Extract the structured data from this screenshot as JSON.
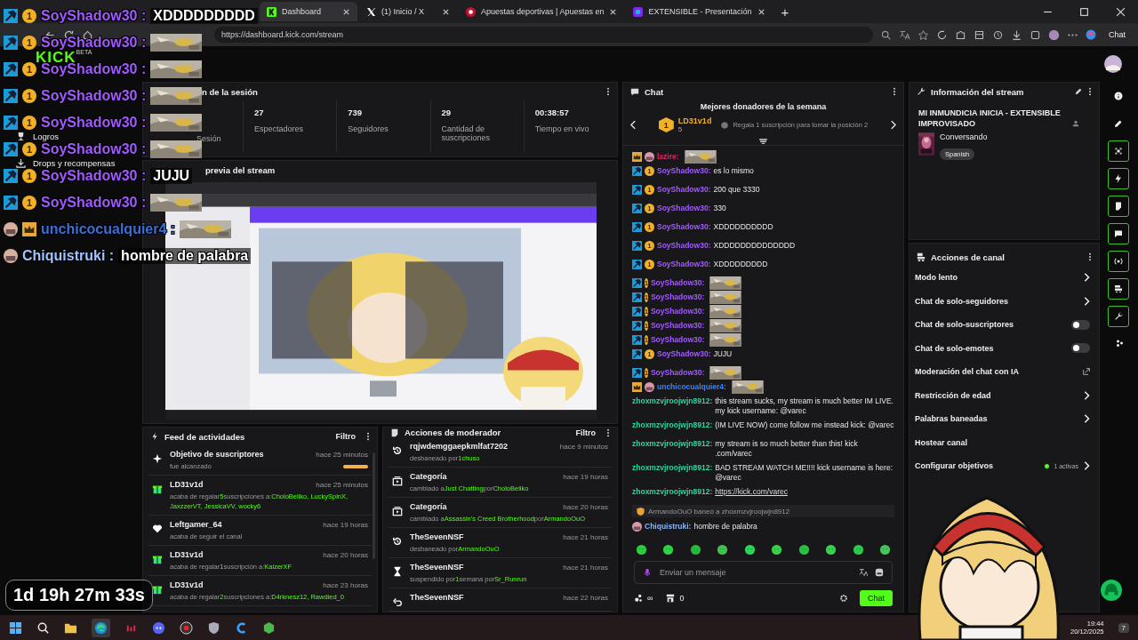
{
  "browser": {
    "tabs": [
      {
        "label": "Dashboard",
        "selected": true
      },
      {
        "label": "(1) Inicio / X",
        "selected": false
      },
      {
        "label": "Apuestas deportivas | Apuestas en",
        "selected": false
      },
      {
        "label": "EXTENSIBLE - Presentación",
        "selected": false
      }
    ],
    "new_tab": "+",
    "url": "https://dashboard.kick.com/stream",
    "chat_button": "Chat"
  },
  "sidebar": {
    "logo": "KICK",
    "beta": "BETA",
    "items": [
      {
        "label": "Logros"
      },
      {
        "label": "Drops y recompensas"
      }
    ]
  },
  "session": {
    "title": "n de la sesión",
    "stats": [
      {
        "label": "Sesión"
      },
      {
        "value": "27",
        "label": "Espectadores"
      },
      {
        "value": "739",
        "label": "Seguidores"
      },
      {
        "value": "29",
        "label": "Cantidad de suscripciones"
      },
      {
        "value": "00:38:57",
        "label": "Tiempo en vivo"
      }
    ]
  },
  "preview": {
    "title": "previa del stream"
  },
  "feed": {
    "title": "Feed de actividades",
    "filter": "Filtro",
    "items": [
      {
        "kind": "goal",
        "name": "Objetivo de suscriptores",
        "time": "hace 25 minutos",
        "level": 1,
        "body": [
          {
            "text": "fue alcanzado",
            "highlight": false
          }
        ]
      },
      {
        "kind": "gift",
        "name": "LD31v1d",
        "time": "hace 25 minutos",
        "body": [
          {
            "text": "acaba de regalar",
            "highlight": false
          },
          {
            "text": "5",
            "highlight": true
          },
          {
            "text": "suscripciones a:",
            "highlight": false
          },
          {
            "text": "CholoBeliko, LuckySpinX, JaxzzerVT, JessicaVV, wocky6",
            "highlight": true
          }
        ]
      },
      {
        "kind": "follow",
        "name": "Leftgamer_64",
        "time": "hace 19 horas",
        "body": [
          {
            "text": "acaba de seguir el canal",
            "highlight": false
          }
        ]
      },
      {
        "kind": "gift",
        "name": "LD31v1d",
        "time": "hace 20 horas",
        "body": [
          {
            "text": "acaba de regalar",
            "highlight": false
          },
          {
            "text": "1",
            "highlight": true
          },
          {
            "text": "suscripción a:",
            "highlight": false
          },
          {
            "text": "KaizerXF",
            "highlight": true
          }
        ]
      },
      {
        "kind": "gift",
        "name": "LD31v1d",
        "time": "hace 23 horas",
        "body": [
          {
            "text": "acaba de regalar",
            "highlight": false
          },
          {
            "text": "2",
            "highlight": true
          },
          {
            "text": "suscripciones a:",
            "highlight": false
          },
          {
            "text": "D4rknesz12, Rawdied_0",
            "highlight": true
          }
        ]
      }
    ]
  },
  "mod_actions": {
    "title": "Acciones de moderador",
    "filter": "Filtro",
    "items": [
      {
        "kind": "unban",
        "name": "rqjwdemggaepkmlfat7202",
        "time": "hace 9 minutos",
        "body": [
          {
            "text": "desbaneado por",
            "highlight": false
          },
          {
            "text": "1chuso",
            "highlight": true
          }
        ]
      },
      {
        "kind": "category",
        "name": "Categoría",
        "time": "hace 19 horas",
        "body": [
          {
            "text": "cambiado a",
            "highlight": false
          },
          {
            "text": "Just Chatting",
            "highlight": true
          },
          {
            "text": "por",
            "highlight": false
          },
          {
            "text": "CholoBeliko",
            "highlight": true
          }
        ]
      },
      {
        "kind": "category",
        "name": "Categoría",
        "time": "hace 20 horas",
        "body": [
          {
            "text": "cambiado a",
            "highlight": false
          },
          {
            "text": "Assassin's Creed Brotherhood",
            "highlight": true
          },
          {
            "text": "por",
            "highlight": false
          },
          {
            "text": "ArmandoOuO",
            "highlight": true
          }
        ]
      },
      {
        "kind": "unban",
        "name": "TheSevenNSF",
        "time": "hace 21 horas",
        "body": [
          {
            "text": "desbaneado por",
            "highlight": false
          },
          {
            "text": "ArmandoOuO",
            "highlight": true
          }
        ]
      },
      {
        "kind": "timeout",
        "name": "TheSevenNSF",
        "time": "hace 21 horas",
        "body": [
          {
            "text": "suspendido por",
            "highlight": false
          },
          {
            "text": "1",
            "highlight": true
          },
          {
            "text": "semana por",
            "highlight": false
          },
          {
            "text": "Sr_Runrun",
            "highlight": true
          }
        ]
      },
      {
        "kind": "undo",
        "name": "TheSevenNSF",
        "time": "hace 22 horas"
      }
    ]
  },
  "chat": {
    "title": "Chat",
    "donors_title": "Mejores donadores de la semana",
    "donor": {
      "rank": "1",
      "name": "LD31v1d",
      "count": "5",
      "hint": "Regala 1 suscripción para tomar la posición 2"
    },
    "messages": [
      {
        "kind": "emote",
        "user": "lazire:",
        "color": "#e0245e",
        "badges": [
          {
            "kind": "crown"
          },
          {
            "kind": "avatar"
          }
        ]
      },
      {
        "kind": "text",
        "user": "SoyShadow30:",
        "color": "#a259ff",
        "badges": [
          {
            "kind": "mod"
          },
          {
            "kind": "rank",
            "text": "1"
          }
        ],
        "text": "es lo mismo"
      },
      {
        "kind": "text",
        "user": "SoyShadow30:",
        "color": "#a259ff",
        "badges": [
          {
            "kind": "mod"
          },
          {
            "kind": "rank",
            "text": "1"
          }
        ],
        "text": "200 que 3330"
      },
      {
        "kind": "text",
        "user": "SoyShadow30:",
        "color": "#a259ff",
        "badges": [
          {
            "kind": "mod"
          },
          {
            "kind": "rank",
            "text": "1"
          }
        ],
        "text": "330"
      },
      {
        "kind": "text",
        "user": "SoyShadow30:",
        "color": "#a259ff",
        "badges": [
          {
            "kind": "mod"
          },
          {
            "kind": "rank",
            "text": "1"
          }
        ],
        "text": "XDDDDDDDDDD"
      },
      {
        "kind": "text",
        "user": "SoyShadow30:",
        "color": "#a259ff",
        "badges": [
          {
            "kind": "mod"
          },
          {
            "kind": "rank",
            "text": "1"
          }
        ],
        "text": "XDDDDDDDDDDDDDD"
      },
      {
        "kind": "text",
        "user": "SoyShadow30:",
        "color": "#a259ff",
        "badges": [
          {
            "kind": "mod"
          },
          {
            "kind": "rank",
            "text": "1"
          }
        ],
        "text": "XDDDDDDDDD"
      },
      {
        "kind": "emote",
        "user": "SoyShadow30:",
        "color": "#a259ff",
        "badges": [
          {
            "kind": "mod"
          },
          {
            "kind": "rank",
            "text": "1"
          }
        ]
      },
      {
        "kind": "emote",
        "user": "SoyShadow30:",
        "color": "#a259ff",
        "badges": [
          {
            "kind": "mod"
          },
          {
            "kind": "rank",
            "text": "1"
          }
        ]
      },
      {
        "kind": "emote",
        "user": "SoyShadow30:",
        "color": "#a259ff",
        "badges": [
          {
            "kind": "mod"
          },
          {
            "kind": "rank",
            "text": "1"
          }
        ]
      },
      {
        "kind": "emote",
        "user": "SoyShadow30:",
        "color": "#a259ff",
        "badges": [
          {
            "kind": "mod"
          },
          {
            "kind": "rank",
            "text": "1"
          }
        ]
      },
      {
        "kind": "emote",
        "user": "SoyShadow30:",
        "color": "#a259ff",
        "badges": [
          {
            "kind": "mod"
          },
          {
            "kind": "rank",
            "text": "1"
          }
        ]
      },
      {
        "kind": "text",
        "user": "SoyShadow30:",
        "color": "#a259ff",
        "badges": [
          {
            "kind": "mod"
          },
          {
            "kind": "rank",
            "text": "1"
          }
        ],
        "text": "JUJU"
      },
      {
        "kind": "emote",
        "user": "SoyShadow30:",
        "color": "#a259ff",
        "badges": [
          {
            "kind": "mod"
          },
          {
            "kind": "rank",
            "text": "1"
          }
        ]
      },
      {
        "kind": "emote",
        "user": "unchicocualquier4:",
        "color": "#3b82f6",
        "badges": [
          {
            "kind": "crown"
          },
          {
            "kind": "avatar"
          }
        ]
      },
      {
        "kind": "text",
        "user": "zhoxmzvjroojwjn8912:",
        "color": "#2fd3a0",
        "text": "this stream sucks, my stream is much better IM LIVE. my kick username: @varec"
      },
      {
        "kind": "text",
        "user": "zhoxmzvjroojwjn8912:",
        "color": "#2fd3a0",
        "text": "(IM LIVE NOW) come follow me instead kick: @varec"
      },
      {
        "kind": "text",
        "user": "zhoxmzvjroojwjn8912:",
        "color": "#2fd3a0",
        "text": "my stream is so much better than this! kick .com/varec"
      },
      {
        "kind": "text",
        "user": "zhoxmzvjroojwjn8912:",
        "color": "#2fd3a0",
        "text": "BAD STREAM WATCH ME!!!! kick username is here: @varec"
      },
      {
        "kind": "link",
        "user": "zhoxmzvjroojwjn8912:",
        "color": "#2fd3a0",
        "text": "https://kick.com/varec"
      },
      {
        "kind": "system",
        "text": "ArmandoOuO baneó a zhoxmzvjroojwjn8912"
      },
      {
        "kind": "text",
        "user": "Chiquistruki:",
        "color": "#8ab4f8",
        "badges": [
          {
            "kind": "avatar"
          }
        ],
        "text": "hombre de palabra"
      }
    ],
    "placeholder": "Enviar un mensaje",
    "points": "∞",
    "drops": "0",
    "send": "Chat"
  },
  "stream_info": {
    "title": "Información del stream",
    "stream_title": "MI INMUNDICIA INICIA - EXTENSIBLE IMPROVISADO",
    "category": "Conversando",
    "tags": [
      "Spanish"
    ]
  },
  "channel_actions": {
    "title": "Acciones de canal",
    "items": [
      {
        "kind": "arrow",
        "label": "Modo lento"
      },
      {
        "kind": "arrow",
        "label": "Chat de solo-seguidores"
      },
      {
        "kind": "toggle",
        "label": "Chat de solo-suscriptores",
        "on": false
      },
      {
        "kind": "toggle",
        "label": "Chat de solo-emotes",
        "on": false
      },
      {
        "kind": "external",
        "label": "Moderación del chat con IA"
      },
      {
        "kind": "arrow",
        "label": "Restricción de edad"
      },
      {
        "kind": "arrow",
        "label": "Palabras baneadas"
      },
      {
        "kind": "plain",
        "label": "Hostear canal"
      },
      {
        "kind": "arrow",
        "label": "Configurar objetivos",
        "badge": "1 activas"
      }
    ]
  },
  "rail": [
    {
      "on": false
    },
    {
      "on": false
    },
    {
      "on": true
    },
    {
      "on": true
    },
    {
      "on": true
    },
    {
      "on": true
    },
    {
      "on": true
    },
    {
      "on": true
    },
    {
      "on": true
    },
    {
      "on": false
    }
  ],
  "overlay": {
    "lines": [
      {
        "kind": "text",
        "user": "SoyShadow30 :",
        "color": "#a259ff",
        "badges": [
          {
            "kind": "mod"
          },
          {
            "kind": "rank",
            "text": "1"
          }
        ],
        "text": "XDDDDDDDDD"
      },
      {
        "kind": "emote",
        "user": "SoyShadow30 :",
        "color": "#a259ff",
        "badges": [
          {
            "kind": "mod"
          },
          {
            "kind": "rank",
            "text": "1"
          }
        ]
      },
      {
        "kind": "emote",
        "user": "SoyShadow30 :",
        "color": "#a259ff",
        "badges": [
          {
            "kind": "mod"
          },
          {
            "kind": "rank",
            "text": "1"
          }
        ]
      },
      {
        "kind": "emote",
        "user": "SoyShadow30 :",
        "color": "#a259ff",
        "badges": [
          {
            "kind": "mod"
          },
          {
            "kind": "rank",
            "text": "1"
          }
        ]
      },
      {
        "kind": "emote",
        "user": "SoyShadow30 :",
        "color": "#a259ff",
        "badges": [
          {
            "kind": "mod"
          },
          {
            "kind": "rank",
            "text": "1"
          }
        ]
      },
      {
        "kind": "emote",
        "user": "SoyShadow30 :",
        "color": "#a259ff",
        "badges": [
          {
            "kind": "mod"
          },
          {
            "kind": "rank",
            "text": "1"
          }
        ]
      },
      {
        "kind": "text",
        "user": "SoyShadow30 :",
        "color": "#a259ff",
        "badges": [
          {
            "kind": "mod"
          },
          {
            "kind": "rank",
            "text": "1"
          }
        ],
        "text": "JUJU"
      },
      {
        "kind": "emote",
        "user": "SoyShadow30 :",
        "color": "#a259ff",
        "badges": [
          {
            "kind": "mod"
          },
          {
            "kind": "rank",
            "text": "1"
          }
        ]
      },
      {
        "kind": "emote",
        "user": "unchicocualquier4 :",
        "color": "#3b6fd6",
        "badges": [
          {
            "kind": "avatar"
          },
          {
            "kind": "crown"
          }
        ]
      },
      {
        "kind": "text",
        "user": "Chiquistruki :",
        "color": "#9ec3ff",
        "badges": [
          {
            "kind": "avatar"
          }
        ],
        "text": "hombre de palabra"
      }
    ],
    "timer": "1d 19h 27m 33s"
  },
  "taskbar": {
    "time": "19:44",
    "date": "20/12/2025",
    "notifications": "7"
  }
}
